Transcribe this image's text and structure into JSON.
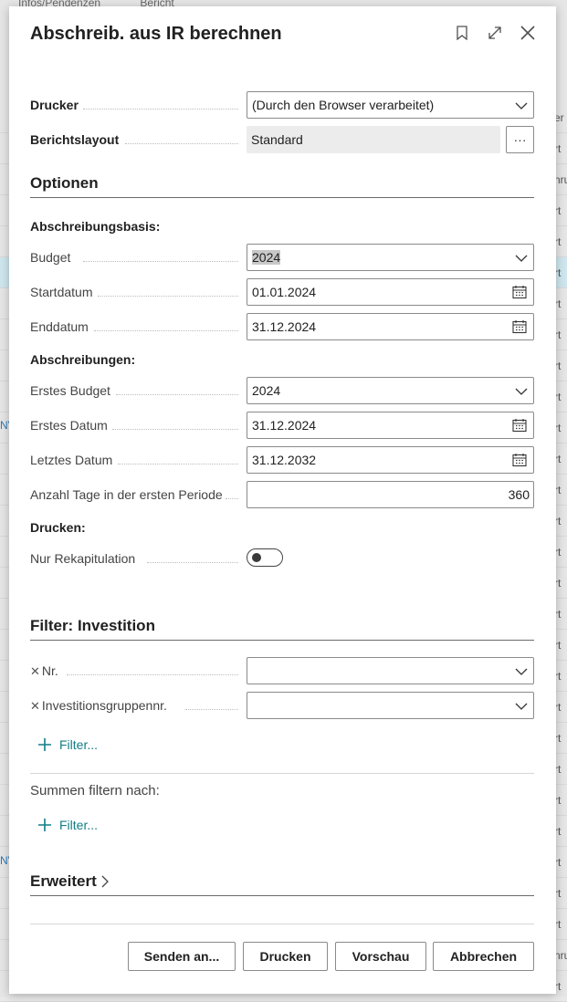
{
  "background": {
    "top_items": [
      "Infos/Pendenzen",
      "Bericht"
    ],
    "right_fragments": [
      "er",
      "rt",
      "nru",
      "rt",
      "rt",
      "rt",
      "rt",
      "rt",
      "rt",
      "rt",
      "rt",
      "rt",
      "rt",
      "rt",
      "rt",
      "rt",
      "rt",
      "rt",
      "rt",
      "rt",
      "rt",
      "rt",
      "rt",
      "rt",
      "rt",
      "rt",
      "rt",
      "nru",
      "rt"
    ],
    "left_fragments": [
      "NV",
      "NV"
    ]
  },
  "dialog": {
    "title": "Abschreib. aus IR berechnen"
  },
  "printer": {
    "label": "Drucker",
    "value": "(Durch den Browser verarbeitet)"
  },
  "report_layout": {
    "label": "Berichtslayout",
    "value": "Standard",
    "more_label": "···"
  },
  "options": {
    "heading": "Optionen",
    "basis_heading": "Abschreibungsbasis:",
    "budget": {
      "label": "Budget",
      "value": "2024"
    },
    "start_date": {
      "label": "Startdatum",
      "value": "01.01.2024"
    },
    "end_date": {
      "label": "Enddatum",
      "value": "31.12.2024"
    },
    "depr_heading": "Abschreibungen:",
    "first_budget": {
      "label": "Erstes Budget",
      "value": "2024"
    },
    "first_date": {
      "label": "Erstes Datum",
      "value": "31.12.2024"
    },
    "last_date": {
      "label": "Letztes Datum",
      "value": "31.12.2032"
    },
    "days_first_period": {
      "label": "Anzahl Tage in der ersten Periode",
      "value": "360"
    },
    "print_heading": "Drucken:",
    "recap_only": {
      "label": "Nur Rekapitulation",
      "checked": false
    }
  },
  "filter": {
    "heading": "Filter: Investition",
    "no": {
      "label": "Nr.",
      "value": ""
    },
    "group_no": {
      "label": "Investitionsgruppennr.",
      "value": ""
    },
    "add_filter_label": "Filter...",
    "totals_heading": "Summen filtern nach:",
    "add_totals_filter_label": "Filter..."
  },
  "advanced": {
    "heading": "Erweitert"
  },
  "footer": {
    "send_to": "Senden an...",
    "print": "Drucken",
    "preview": "Vorschau",
    "cancel": "Abbrechen"
  },
  "colors": {
    "accent": "#127d86",
    "toggle_knob": "#3a3a3a"
  }
}
